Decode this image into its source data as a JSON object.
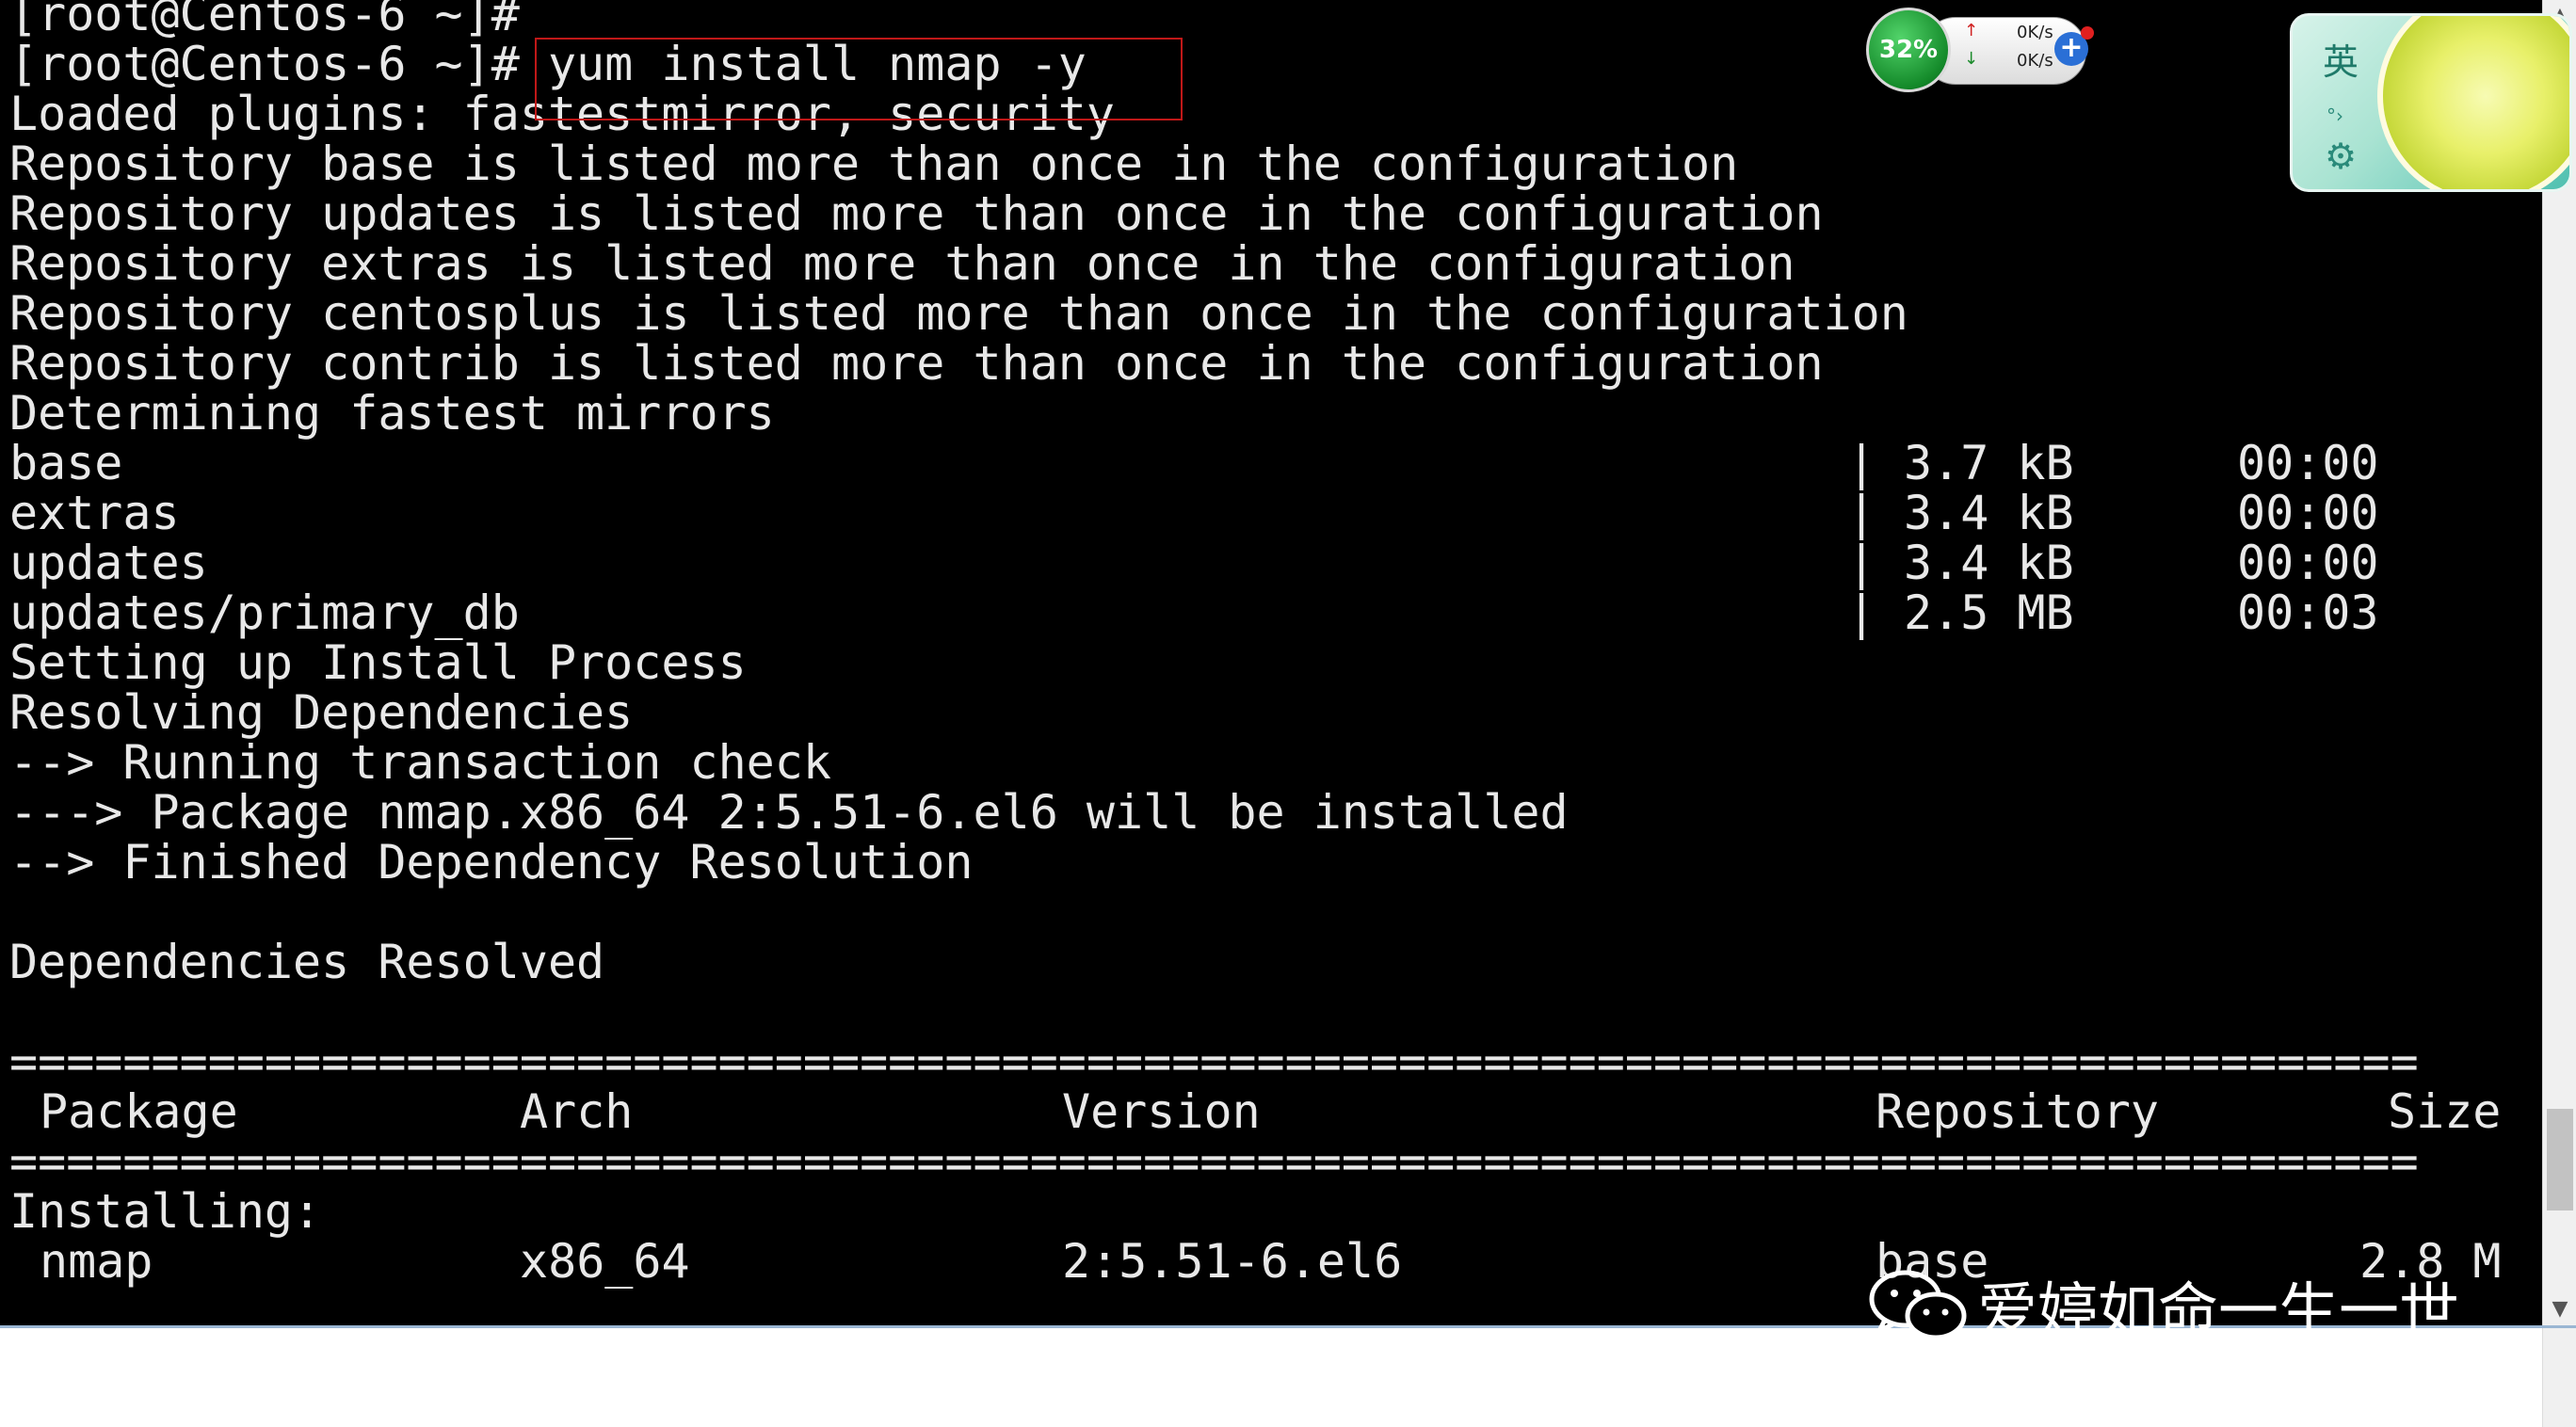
{
  "terminal": {
    "lines": [
      "[root@Centos-6 ~]#",
      "[root@Centos-6 ~]# yum install nmap -y",
      "Loaded plugins: fastestmirror, security",
      "Repository base is listed more than once in the configuration",
      "Repository updates is listed more than once in the configuration",
      "Repository extras is listed more than once in the configuration",
      "Repository centosplus is listed more than once in the configuration",
      "Repository contrib is listed more than once in the configuration",
      "Determining fastest mirrors",
      "base",
      "extras",
      "updates",
      "updates/primary_db",
      "Setting up Install Process",
      "Resolving Dependencies",
      "--> Running transaction check",
      "---> Package nmap.x86_64 2:5.51-6.el6 will be installed",
      "--> Finished Dependency Resolution",
      "",
      "Dependencies Resolved",
      "",
      "=====================================================================================",
      "",
      "=====================================================================================",
      "Installing:"
    ],
    "downloads": [
      {
        "sep": "|",
        "size": "3.7 kB",
        "time": "00:00"
      },
      {
        "sep": "|",
        "size": "3.4 kB",
        "time": "00:00"
      },
      {
        "sep": "|",
        "size": "3.4 kB",
        "time": "00:00"
      },
      {
        "sep": "|",
        "size": "2.5 MB",
        "time": "00:03"
      }
    ],
    "table_headers": {
      "package": "Package",
      "arch": "Arch",
      "version": "Version",
      "repository": "Repository",
      "size": "Size"
    },
    "table_row": {
      "package": "nmap",
      "arch": "x86_64",
      "version": "2:5.51-6.el6",
      "repository": "base",
      "size": "2.8 M"
    }
  },
  "net_widget": {
    "cpu_percent": "32%",
    "upload": "0K/s",
    "download": "0K/s",
    "up_arrow": "↑",
    "down_arrow": "↓",
    "plus": "+"
  },
  "ime": {
    "lang": "英",
    "dots": "°›",
    "gear": "⚙"
  },
  "watermark": {
    "text": "爱婷如命一生一世"
  },
  "scrollbar": {
    "up": "▲",
    "down": "▼"
  }
}
